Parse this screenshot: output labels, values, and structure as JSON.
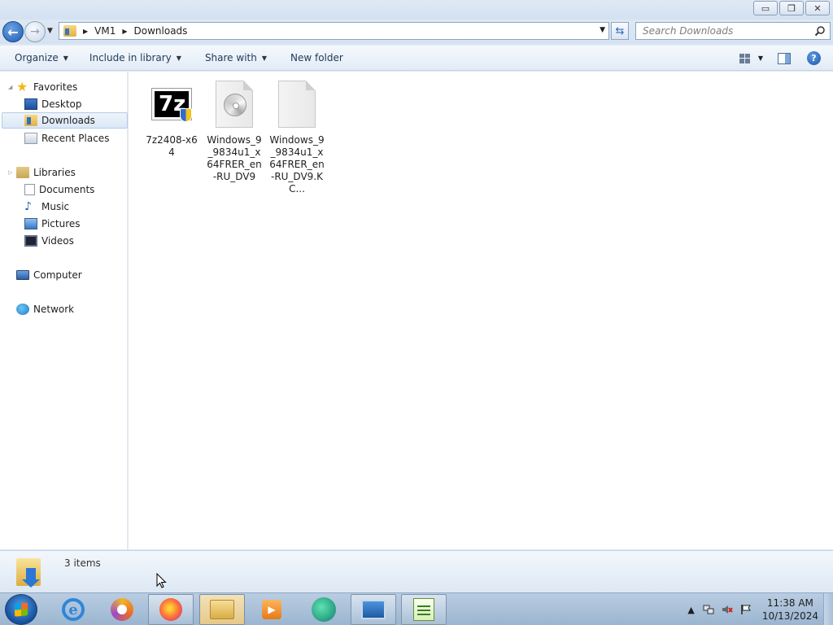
{
  "window": {
    "minimize_glyph": "▭",
    "maximize_glyph": "❐",
    "close_glyph": "✕"
  },
  "address": {
    "crumbs": [
      "VM1",
      "Downloads"
    ]
  },
  "search": {
    "placeholder": "Search Downloads"
  },
  "toolbar": {
    "organize": "Organize",
    "include_in_library": "Include in library",
    "share_with": "Share with",
    "new_folder": "New folder",
    "help": "?"
  },
  "nav": {
    "favorites": "Favorites",
    "desktop": "Desktop",
    "downloads": "Downloads",
    "recent_places": "Recent Places",
    "libraries": "Libraries",
    "documents": "Documents",
    "music": "Music",
    "pictures": "Pictures",
    "videos": "Videos",
    "computer": "Computer",
    "network": "Network"
  },
  "files": [
    {
      "name": "7z2408-x64",
      "icon": "7zip-installer-icon"
    },
    {
      "name": "Windows_9_9834u1_x64FRER_en-RU_DV9",
      "icon": "disc-image-icon"
    },
    {
      "name": "Windows_9_9834u1_x64FRER_en-RU_DV9.KC...",
      "icon": "generic-file-icon"
    }
  ],
  "details": {
    "item_count": "3 items"
  },
  "taskbar": {
    "apps": [
      "internet-explorer",
      "browser",
      "firefox",
      "windows-explorer",
      "media-player",
      "messenger",
      "remote-desktop",
      "notepad-plus-plus"
    ],
    "active": "windows-explorer"
  },
  "tray": {
    "time": "11:38 AM",
    "date": "10/13/2024",
    "show_hidden": "▲"
  },
  "colors": {
    "accent": "#1d5db5",
    "selection": "#dbe8f6"
  }
}
